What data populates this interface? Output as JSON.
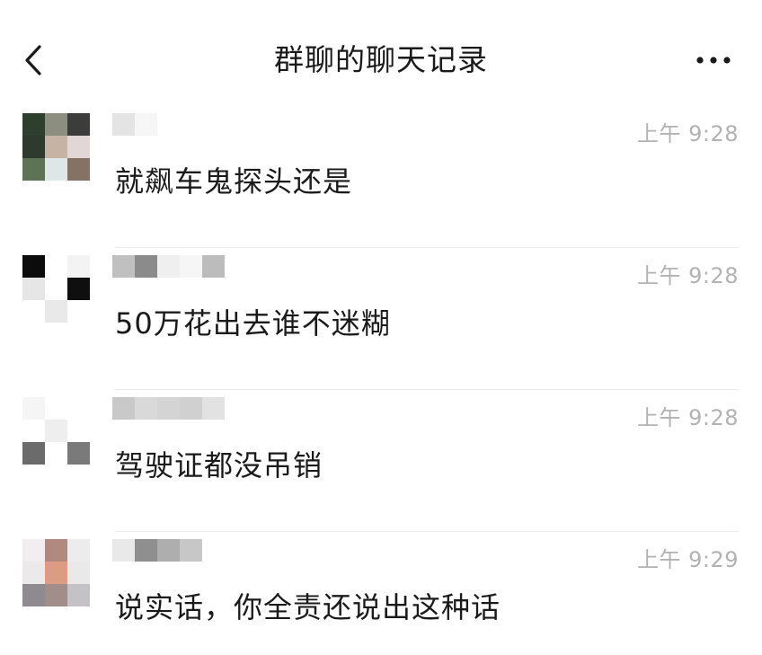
{
  "header": {
    "title": "群聊的聊天记录",
    "back_icon": "chevron-left-icon",
    "more_icon": "more-horizontal-icon"
  },
  "messages": [
    {
      "time": "上午 9:28",
      "text": "就飙车鬼探头还是",
      "avatar_colors": [
        "#2f3f2e",
        "#8c8f80",
        "#3a3d3a",
        "#2d3a2d",
        "#c7b3a3",
        "#e3d6d6",
        "#5e7356",
        "#dfe6e8",
        "#867265"
      ],
      "name_colors": [
        "#e4e4e4",
        "#f6f6f6",
        "#ffffff",
        "#ffffff",
        "#ffffff"
      ]
    },
    {
      "time": "上午 9:28",
      "text": "50万花出去谁不迷糊",
      "avatar_colors": [
        "#0c0c0c",
        "#ffffff",
        "#f3f3f3",
        "#e6e6e6",
        "#ffffff",
        "#0f0f0f",
        "#ffffff",
        "#e9e9e9",
        "#ffffff"
      ],
      "name_colors": [
        "#c0c0c0",
        "#8b8b8b",
        "#efefef",
        "#f6f6f6",
        "#bcbcbc"
      ]
    },
    {
      "time": "上午 9:28",
      "text": "驾驶证都没吊销",
      "avatar_colors": [
        "#f5f5f5",
        "#ffffff",
        "#ffffff",
        "#ffffff",
        "#eeeeee",
        "#ffffff",
        "#6b6b6b",
        "#ffffff",
        "#7a7a7a"
      ],
      "name_colors": [
        "#c9c9c9",
        "#d9d9d9",
        "#d4d4d4",
        "#d0d0d0",
        "#e2e2e2"
      ]
    },
    {
      "time": "上午 9:29",
      "text": "说实话，你全责还说出这种话",
      "avatar_colors": [
        "#f1edf0",
        "#b08a7e",
        "#ecebee",
        "#ece9ea",
        "#dc9b83",
        "#ebe8ea",
        "#8f8a8f",
        "#a18e8b",
        "#c4c2c6"
      ],
      "name_colors": [
        "#e9e9e9",
        "#8f8f8f",
        "#aeaeae",
        "#c7c7c7",
        "#ffffff"
      ]
    }
  ],
  "colors": {
    "title": "#1a1a1a",
    "text": "#1a1a1a",
    "time": "#b2b2b2",
    "divider": "#ececec",
    "background": "#ffffff"
  }
}
